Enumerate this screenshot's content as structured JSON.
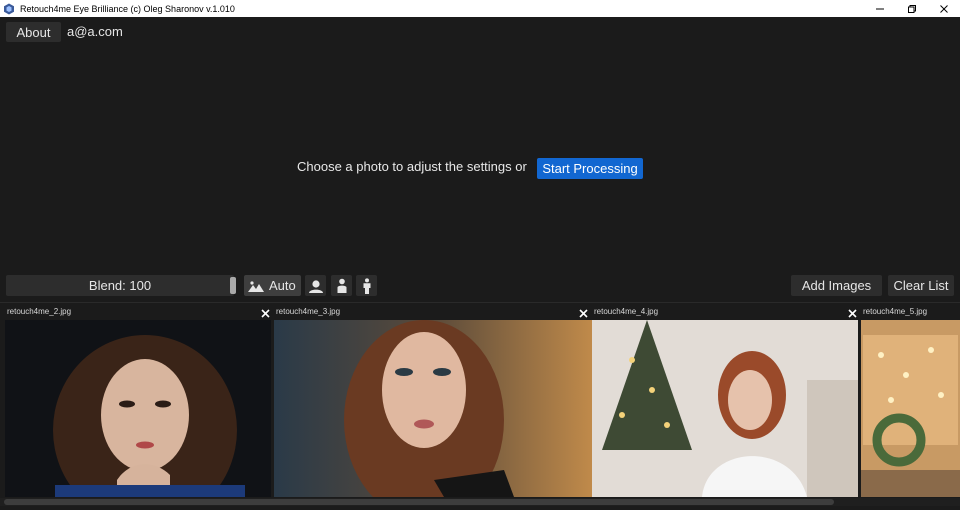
{
  "window": {
    "title": "Retouch4me Eye Brilliance (c) Oleg Sharonov v.1.010",
    "controls": [
      "minimize-icon",
      "restore-icon",
      "close-icon"
    ]
  },
  "topbar": {
    "about_label": "About",
    "account_email": "a@a.com"
  },
  "center": {
    "prompt_text": "Choose a photo to adjust the settings or",
    "start_label": "Start Processing"
  },
  "toolbar": {
    "blend_label": "Blend: 100",
    "blend_value": 100,
    "auto_label": "Auto",
    "mode_icons": [
      "portrait-face-icon",
      "portrait-half-body-icon",
      "portrait-full-body-icon"
    ],
    "add_images_label": "Add Images",
    "clear_list_label": "Clear List"
  },
  "thumbnails": [
    {
      "name": "retouch4me_2.jpg"
    },
    {
      "name": "retouch4me_3.jpg"
    },
    {
      "name": "retouch4me_4.jpg"
    },
    {
      "name": "retouch4me_5.jpg"
    }
  ],
  "colors": {
    "background": "#1b1b1b",
    "accent": "#1267d1",
    "button": "#2d2d2d"
  }
}
